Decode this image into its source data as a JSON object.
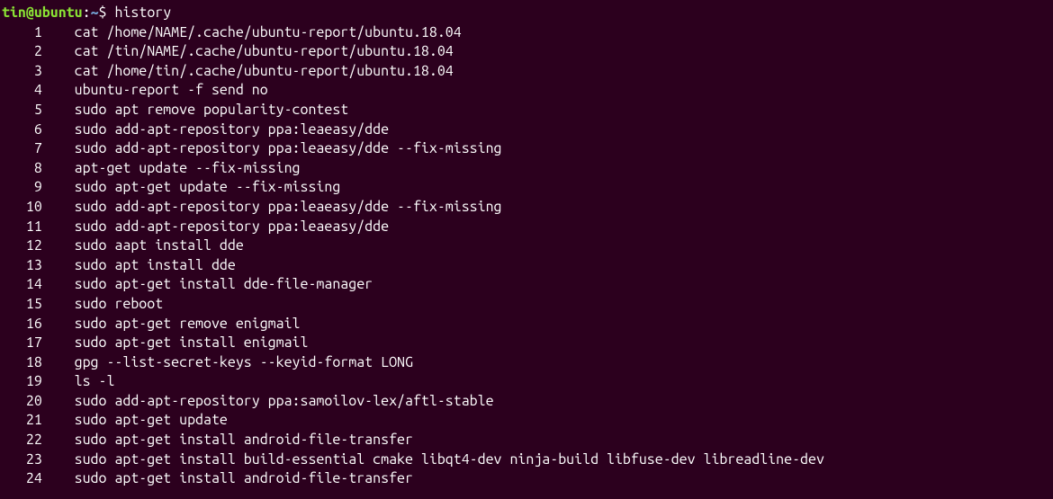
{
  "prompt": {
    "user_host": "tin@ubuntu",
    "colon": ":",
    "cwd": "~",
    "dollar": "$",
    "typed_command": "history"
  },
  "history": [
    {
      "num": "1",
      "cmd": "cat /home/NAME/.cache/ubuntu-report/ubuntu.18.04"
    },
    {
      "num": "2",
      "cmd": "cat /tin/NAME/.cache/ubuntu-report/ubuntu.18.04"
    },
    {
      "num": "3",
      "cmd": "cat /home/tin/.cache/ubuntu-report/ubuntu.18.04"
    },
    {
      "num": "4",
      "cmd": "ubuntu-report -f send no"
    },
    {
      "num": "5",
      "cmd": "sudo apt remove popularity-contest"
    },
    {
      "num": "6",
      "cmd": "sudo add-apt-repository ppa:leaeasy/dde"
    },
    {
      "num": "7",
      "cmd": "sudo add-apt-repository ppa:leaeasy/dde --fix-missing"
    },
    {
      "num": "8",
      "cmd": "apt-get update --fix-missing"
    },
    {
      "num": "9",
      "cmd": "sudo apt-get update --fix-missing"
    },
    {
      "num": "10",
      "cmd": "sudo add-apt-repository ppa:leaeasy/dde --fix-missing"
    },
    {
      "num": "11",
      "cmd": "sudo add-apt-repository ppa:leaeasy/dde"
    },
    {
      "num": "12",
      "cmd": "sudo aapt install dde"
    },
    {
      "num": "13",
      "cmd": "sudo apt install dde"
    },
    {
      "num": "14",
      "cmd": "sudo apt-get install dde-file-manager"
    },
    {
      "num": "15",
      "cmd": "sudo reboot"
    },
    {
      "num": "16",
      "cmd": "sudo apt-get remove enigmail"
    },
    {
      "num": "17",
      "cmd": "sudo apt-get install enigmail"
    },
    {
      "num": "18",
      "cmd": "gpg --list-secret-keys --keyid-format LONG"
    },
    {
      "num": "19",
      "cmd": "ls -l"
    },
    {
      "num": "20",
      "cmd": "sudo add-apt-repository ppa:samoilov-lex/aftl-stable"
    },
    {
      "num": "21",
      "cmd": "sudo apt-get update"
    },
    {
      "num": "22",
      "cmd": "sudo apt-get install android-file-transfer"
    },
    {
      "num": "23",
      "cmd": "sudo apt-get install build-essential cmake libqt4-dev ninja-build libfuse-dev libreadline-dev"
    },
    {
      "num": "24",
      "cmd": "sudo apt-get install android-file-transfer"
    }
  ]
}
